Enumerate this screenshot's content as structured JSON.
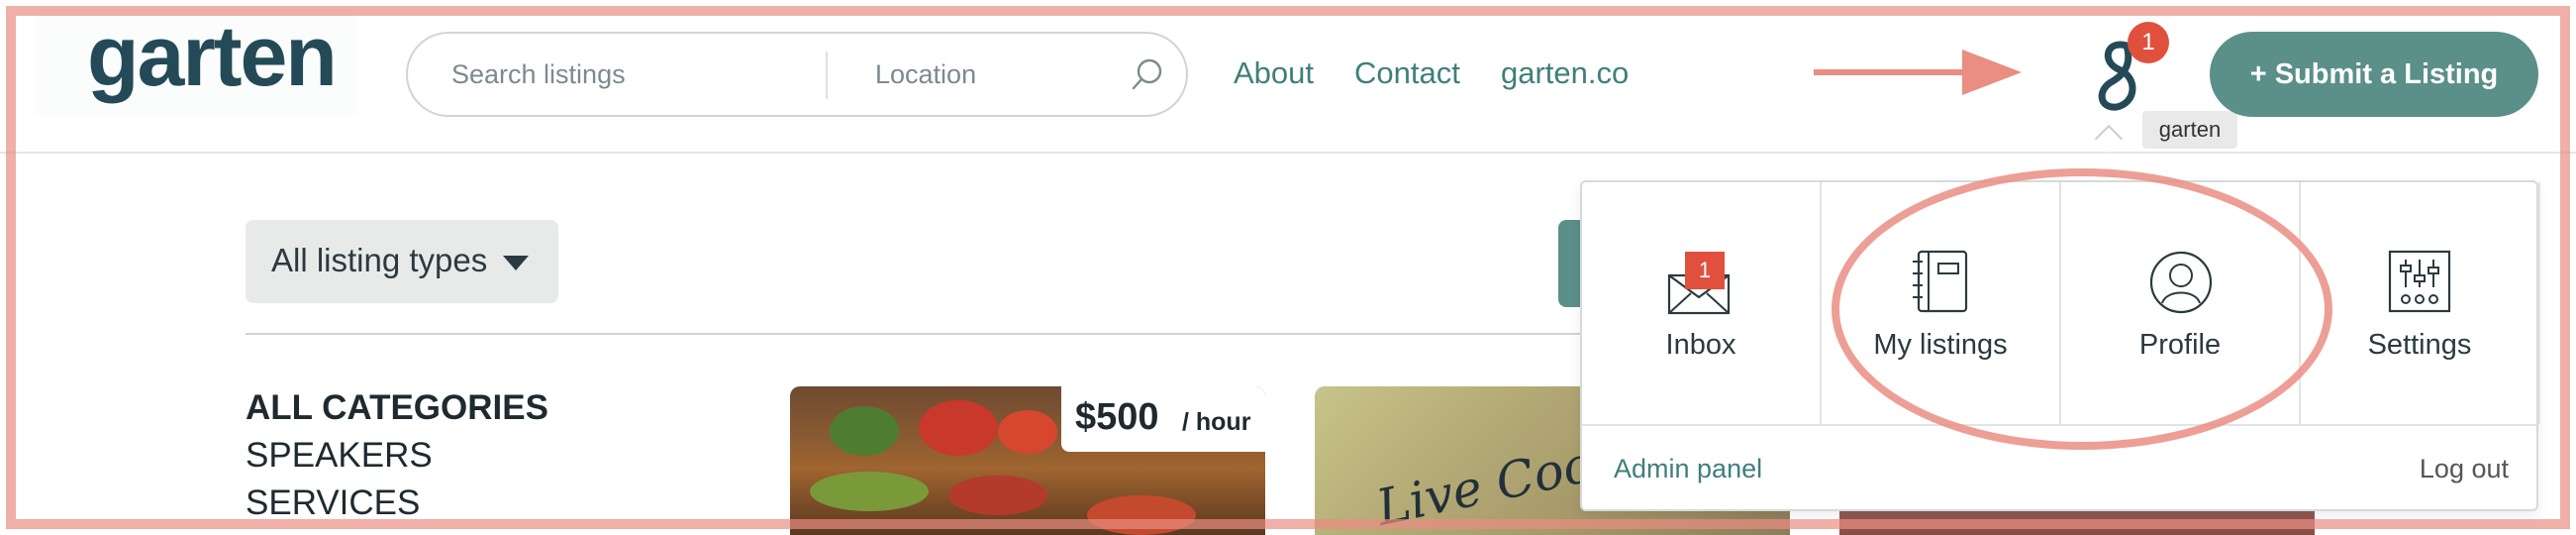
{
  "header": {
    "logo_text": "garten",
    "search": {
      "listings_placeholder": "Search listings",
      "location_placeholder": "Location"
    },
    "nav": [
      {
        "label": "About"
      },
      {
        "label": "Contact"
      },
      {
        "label": "garten.co"
      }
    ],
    "notification_count": "1",
    "user_tooltip": "garten",
    "submit_label": "+ Submit a Listing"
  },
  "filters": {
    "listing_types_label": "All listing types"
  },
  "categories": [
    {
      "label": "ALL CATEGORIES"
    },
    {
      "label": "SPEAKERS"
    },
    {
      "label": "SERVICES"
    }
  ],
  "cards": [
    {
      "price_amount": "$500",
      "price_unit": "/ hour"
    },
    {
      "image_text": "Live Cooking"
    }
  ],
  "user_menu": {
    "items": [
      {
        "label": "Inbox",
        "icon": "inbox-icon",
        "badge": "1"
      },
      {
        "label": "My listings",
        "icon": "notebook-icon"
      },
      {
        "label": "Profile",
        "icon": "profile-icon"
      },
      {
        "label": "Settings",
        "icon": "sliders-icon"
      }
    ],
    "admin_label": "Admin panel",
    "logout_label": "Log out"
  },
  "colors": {
    "brand_teal": "#5b8f8a",
    "logo_navy": "#244a57",
    "badge_red": "#e1503c",
    "annotation": "#ea8d82"
  }
}
